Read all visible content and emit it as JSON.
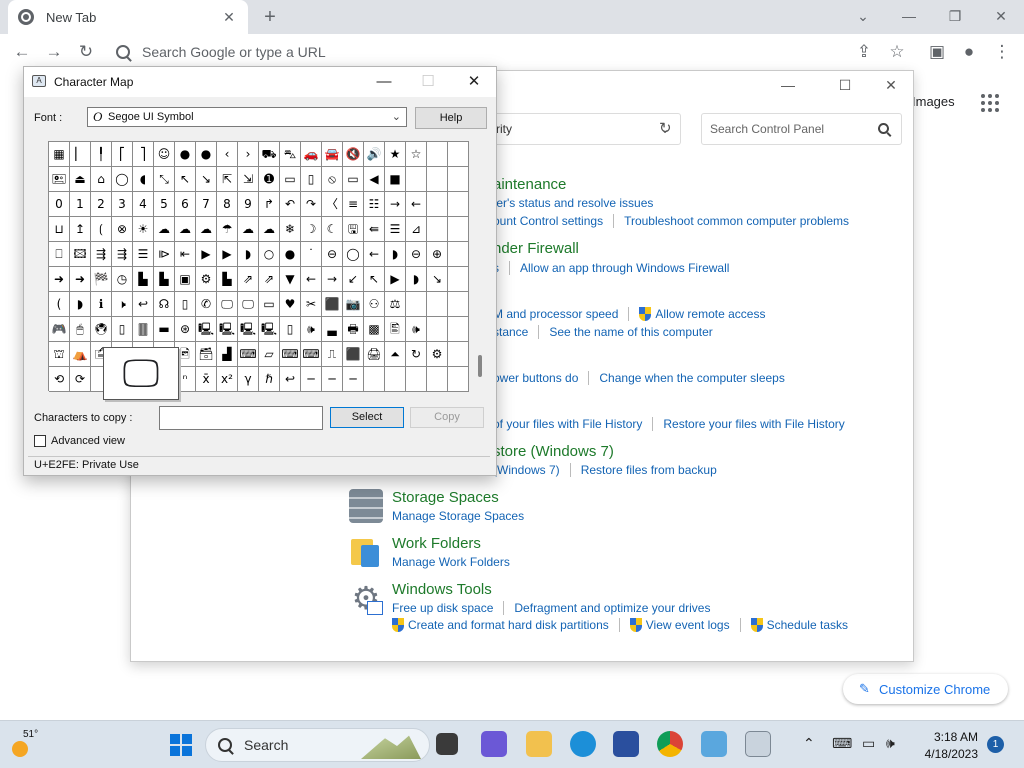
{
  "chrome": {
    "tab_title": "New Tab",
    "omnibox_placeholder": "Search Google or type a URL",
    "images_link": "Images",
    "customize_label": "Customize Chrome"
  },
  "control_panel": {
    "address_text": "rity",
    "search_placeholder": "Search Control Panel",
    "categories": [
      {
        "title": "aintenance",
        "lines": [
          [
            "ter's status and resolve issues"
          ],
          [
            "ount Control settings",
            "Troubleshoot common computer problems"
          ]
        ]
      },
      {
        "title": "nder Firewall",
        "lines": [
          [
            "s",
            "Allow an app through Windows Firewall"
          ]
        ]
      },
      {
        "title": "",
        "lines": [
          [
            "M and processor speed",
            "Allow remote access"
          ],
          [
            "stance",
            "See the name of this computer"
          ]
        ]
      },
      {
        "title": "",
        "lines": [
          [
            "ower buttons do",
            "Change when the computer sleeps"
          ]
        ]
      },
      {
        "title": "",
        "lines": [
          [
            "of your files with File History",
            "Restore your files with File History"
          ]
        ]
      },
      {
        "title": "store (Windows 7)",
        "lines": [
          [
            "(Windows 7)",
            "Restore files from backup"
          ]
        ]
      },
      {
        "title": "Storage Spaces",
        "lines": [
          [
            "Manage Storage Spaces"
          ]
        ]
      },
      {
        "title": "Work Folders",
        "lines": [
          [
            "Manage Work Folders"
          ]
        ]
      },
      {
        "title": "Windows Tools",
        "lines": [
          [
            "Free up disk space",
            "Defragment and optimize your drives"
          ],
          [
            "Create and format hard disk partitions",
            "View event logs",
            "Schedule tasks"
          ]
        ]
      }
    ]
  },
  "charmap": {
    "title": "Character Map",
    "font_label": "Font :",
    "font_value": "Segoe UI Symbol",
    "help_label": "Help",
    "copy_label": "Characters to copy :",
    "copy_value": "",
    "select_label": "Select",
    "copy_button": "Copy",
    "advanced_label": "Advanced view",
    "status": "U+E2FE: Private Use",
    "zoom_glyph": "🖵",
    "rows": [
      [
        "▦",
        "▏",
        "╿",
        "⎡",
        "⎤",
        "☺",
        "●",
        "●",
        "‹",
        "›",
        "⛟",
        "⛍",
        "🚗",
        "🚘",
        "🔇",
        "🔊",
        "★",
        "☆"
      ],
      [
        "🖭",
        "⏏",
        "⌂",
        "◯",
        "◖",
        "⤡",
        "↖",
        "↘",
        "⇱",
        "⇲",
        "➊",
        "▭",
        "▯",
        "⦸",
        "▭",
        "◀",
        "■"
      ],
      [
        "0",
        "1",
        "2",
        "3",
        "4",
        "5",
        "6",
        "7",
        "8",
        "9",
        "↱",
        "↶",
        "↷",
        "〈",
        "≡",
        "☷",
        "→",
        "←"
      ],
      [
        "⊔",
        "↥",
        "⟮",
        "⊗",
        "☀",
        "☁",
        "☁",
        "☁",
        "☂",
        "☁",
        "☁",
        "❄",
        "☽",
        "☾",
        "🖫",
        "⇚",
        "☰",
        "⊿"
      ],
      [
        "⎕",
        "🖾",
        "⇶",
        "⇶",
        "☰",
        "⧐",
        "⇤",
        "▶",
        "▶",
        "◗",
        "○",
        "●",
        "˙",
        "⊖",
        "◯",
        "←",
        "◗",
        "⊖",
        "⊕"
      ],
      [
        "➜",
        "➜",
        "🏁",
        "◷",
        "▙",
        "▙",
        "▣",
        "⚙",
        "▙",
        "⇗",
        "⇗",
        "▼",
        "←",
        "→",
        "↙",
        "↖",
        "▶",
        "◗",
        "↘"
      ],
      [
        "(",
        "◗",
        "ℹ",
        "🕨",
        "↩",
        "☊",
        "▯",
        "✆",
        "🖵",
        "🖵",
        "▭",
        "♥",
        "✂",
        "⬛",
        "📷",
        "⚇",
        "⚖"
      ],
      [
        "🎮",
        "🖱",
        "🖲",
        "▯",
        "🀫",
        "▬",
        "⊛",
        "🖳",
        "🖳",
        "🖳",
        "🖳",
        "▯",
        "🕪",
        "▃",
        "🖶",
        "▩",
        "🖺",
        "🕪"
      ],
      [
        "⛫",
        "⛺",
        "🖆",
        "",
        "",
        "🖮",
        "🖻",
        "🗃",
        "▟",
        "⌨",
        "▱",
        "⌨",
        "⌨",
        "⎍",
        "⬛",
        "🖨",
        "⏶",
        "↻",
        "⚙"
      ],
      [
        "⟲",
        "⟳",
        "",
        "",
        "",
        "",
        "ⁿ",
        "x̄",
        "x²",
        "γ",
        "ℏ",
        "↩",
        "─",
        "─",
        "─",
        "",
        "",
        "",
        ""
      ]
    ]
  },
  "taskbar": {
    "weather_temp": "51°",
    "search_label": "Search",
    "time": "3:18 AM",
    "date": "4/18/2023",
    "notifications": "1"
  }
}
